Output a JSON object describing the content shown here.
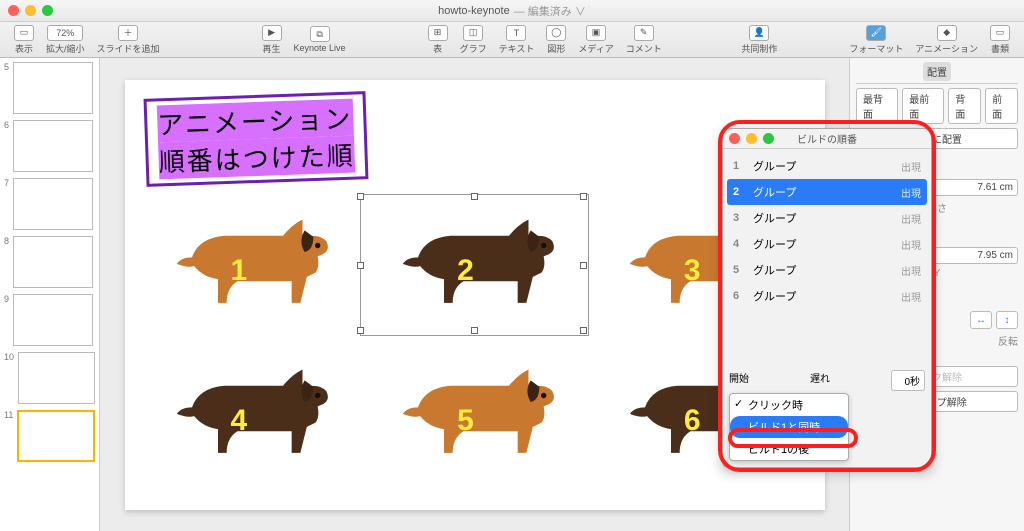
{
  "window": {
    "title": "howto-keynote",
    "subtitle": "— 編集済み ∨"
  },
  "toolbar": {
    "view": "表示",
    "zoom": "72%",
    "zoom_label": "拡大/縮小",
    "add_slide": "スライドを追加",
    "play": "再生",
    "live": "Keynote Live",
    "table": "表",
    "chart": "グラフ",
    "text": "テキスト",
    "shape": "図形",
    "media": "メディア",
    "comment": "コメント",
    "collab": "共同制作",
    "format": "フォーマット",
    "animate": "アニメーション",
    "document": "書類"
  },
  "thumbs": [
    "5",
    "6",
    "7",
    "8",
    "9",
    "10",
    "11"
  ],
  "slide": {
    "title_line1": "アニメーション",
    "title_line2": "順番はつけた順",
    "dogs": [
      {
        "n": "1",
        "fill": "#c8792f"
      },
      {
        "n": "2",
        "fill": "#4a2e1a"
      },
      {
        "n": "3",
        "fill": "#c8792f"
      },
      {
        "n": "4",
        "fill": "#4a2e1a"
      },
      {
        "n": "5",
        "fill": "#c8792f"
      },
      {
        "n": "6",
        "fill": "#4a2e1a"
      }
    ]
  },
  "build": {
    "title": "ビルドの順番",
    "items": [
      {
        "n": "1",
        "name": "グループ",
        "eff": "出現"
      },
      {
        "n": "2",
        "name": "グループ",
        "eff": "出現"
      },
      {
        "n": "3",
        "name": "グループ",
        "eff": "出現"
      },
      {
        "n": "4",
        "name": "グループ",
        "eff": "出現"
      },
      {
        "n": "5",
        "name": "グループ",
        "eff": "出現"
      },
      {
        "n": "6",
        "name": "グループ",
        "eff": "出現"
      }
    ],
    "start_label": "開始",
    "delay_label": "遅れ",
    "delay_val": "0秒",
    "menu": {
      "opt1": "クリック時",
      "opt2": "ビルド1と同時",
      "opt3": "ビルド1の後"
    }
  },
  "inspector": {
    "tab_arrange": "配置",
    "back": "最背面",
    "front": "最前面",
    "backward": "背面",
    "forward": "前面",
    "align": "均等に配置",
    "h_val": "7.61 cm",
    "h_lbl": "高さ",
    "y_val": "7.95 cm",
    "y_lbl": "Y",
    "rotate": "反転",
    "lock": "ロック解除",
    "ungroup": "グループ解除"
  }
}
